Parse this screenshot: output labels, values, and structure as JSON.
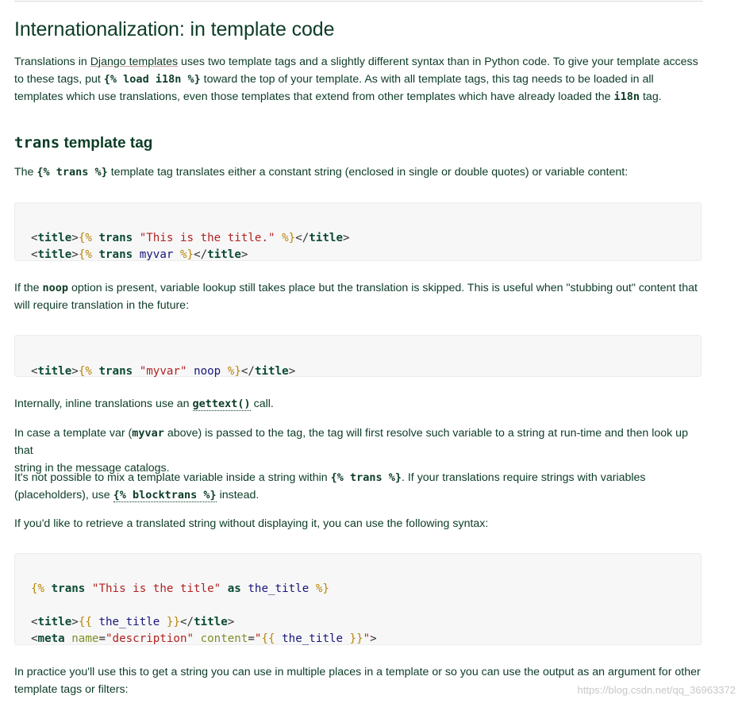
{
  "heading": "Internationalization: in template code",
  "intro": {
    "p1_a": "Translations in ",
    "p1_link": "Django templates",
    "p1_b": " uses two template tags and a slightly different syntax than in Python code. To give your template access",
    "p1_c": "to these tags, put ",
    "p1_code": "{% load i18n %}",
    "p1_d": " toward the top of your template. As with all template tags, this tag needs to be loaded in all",
    "p1_e": "templates which use translations, even those templates that extend from other templates which have already loaded the ",
    "p1_code2": "i18n",
    "p1_f": " tag."
  },
  "subheading": {
    "code": "trans",
    "text": " template tag"
  },
  "p2": {
    "a": "The ",
    "code": "{% trans %}",
    "b": " template tag translates either a constant string (enclosed in single or double quotes) or variable content:"
  },
  "code1": {
    "l1": {
      "lt": "<",
      "tag": "title",
      "gt": ">",
      "o": "{%",
      "kw": "trans",
      "str": "\"This is the title.\"",
      "c": "%}",
      "lt2": "</",
      "tag2": "title",
      "gt2": ">"
    },
    "l2": {
      "lt": "<",
      "tag": "title",
      "gt": ">",
      "o": "{%",
      "kw": "trans",
      "var": "myvar",
      "c": "%}",
      "lt2": "</",
      "tag2": "title",
      "gt2": ">"
    }
  },
  "p3": {
    "a": "If the ",
    "code": "noop",
    "b": " option is present, variable lookup still takes place but the translation is skipped. This is useful when \"stubbing out\" content that",
    "c": "will require translation in the future:"
  },
  "code2": {
    "lt": "<",
    "tag": "title",
    "gt": ">",
    "o": "{%",
    "kw": "trans",
    "str": "\"myvar\"",
    "var": "noop",
    "c": "%}",
    "lt2": "</",
    "tag2": "title",
    "gt2": ">"
  },
  "p4": {
    "a": "Internally, inline translations use an ",
    "code": "gettext()",
    "b": " call."
  },
  "p5": {
    "a": "In case a template var (",
    "code": "myvar",
    "b": " above) is passed to the tag, the tag will first resolve such variable to a string at run-time and then look up that",
    "c": "string in the message catalogs."
  },
  "p6": {
    "a": "It's not possible to mix a template variable inside a string within ",
    "code": "{% trans %}",
    "b": ". If your translations require strings with variables",
    "c": "(placeholders), use ",
    "code2": "{% blocktrans %}",
    "d": " instead."
  },
  "p7": "If you'd like to retrieve a translated string without displaying it, you can use the following syntax:",
  "code3": {
    "l1": {
      "o": "{%",
      "kw": "trans",
      "str": "\"This is the title\"",
      "as": "as",
      "var": "the_title",
      "c": "%}"
    },
    "l2": {
      "lt": "<",
      "tag": "title",
      "gt": ">",
      "o": "{{",
      "var": "the_title",
      "c": "}}",
      "lt2": "</",
      "tag2": "title",
      "gt2": ">"
    },
    "l3": {
      "lt": "<",
      "tag": "meta",
      "attr1": "name",
      "eq1": "=",
      "val1": "\"description\"",
      "attr2": "content",
      "eq2": "=",
      "q1": "\"",
      "o": "{{",
      "var": "the_title",
      "c": "}}",
      "q2": "\"",
      "gt": ">"
    }
  },
  "p8": {
    "a": "In practice you'll use this to get a string you can use in multiple places in a template or so you can use the output as an argument for other",
    "b": "template tags or filters:"
  },
  "watermark": "https://blog.csdn.net/qq_36963372"
}
